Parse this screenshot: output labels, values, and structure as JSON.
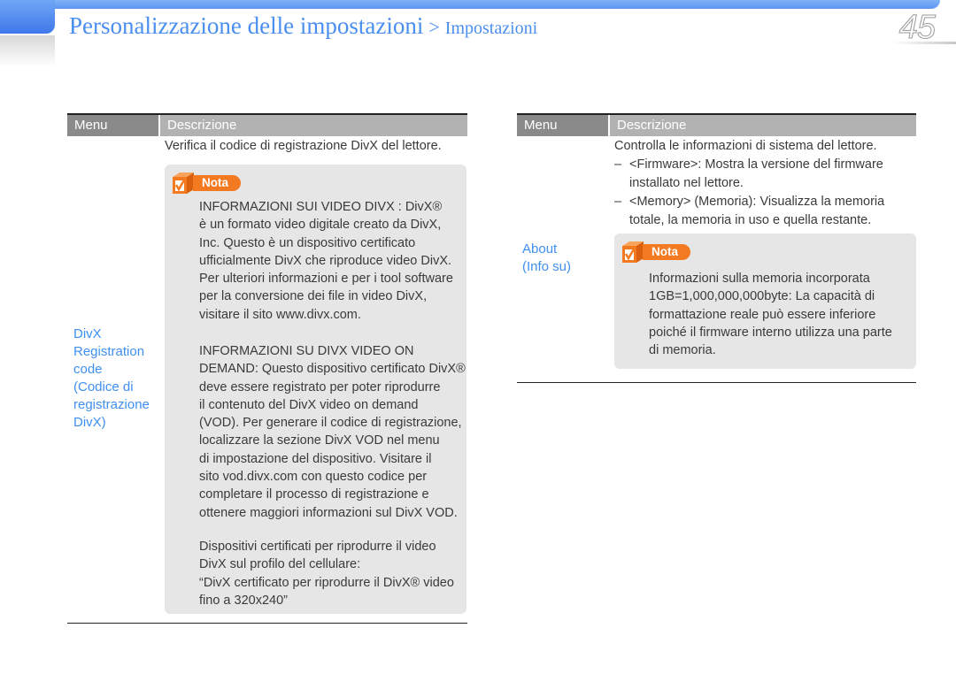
{
  "header": {
    "title": "Personalizzazione delle impostazioni",
    "separator": ">",
    "subtitle": "Impostazioni",
    "page_number": "45",
    "accent_color": "#4a8ef0"
  },
  "left_table": {
    "col_menu": "Menu",
    "col_desc": "Descrizione",
    "row": {
      "menu_lines": [
        "DivX",
        "Registration",
        "code",
        "(Codice di",
        "registrazione",
        "DivX)"
      ],
      "description": "Verifica il codice di registrazione DivX del lettore.",
      "note": {
        "badge": "Nota",
        "icon": "checkbox-cube-icon",
        "paragraphs": [
          [
            "INFORMAZIONI SUI VIDEO DIVX : DivX®",
            "è un formato video digitale creato da DivX,",
            "Inc. Questo è un dispositivo certificato",
            "ufficialmente DivX che riproduce video DivX.",
            "Per ulteriori informazioni e per i tool software",
            "per la conversione dei file in video DivX,",
            "visitare il sito www.divx.com."
          ],
          [
            "INFORMAZIONI SU DIVX VIDEO ON",
            "DEMAND: Questo dispositivo certificato DivX®",
            "deve essere registrato per poter riprodurre",
            "il contenuto del DivX video on demand",
            "(VOD). Per generare il codice di registrazione,",
            "localizzare la sezione DivX VOD nel menu",
            "di impostazione del dispositivo. Visitare il",
            "sito vod.divx.com con questo codice per",
            "completare il processo di registrazione e",
            "ottenere maggiori informazioni sul DivX VOD."
          ],
          [
            "Dispositivi certificati per riprodurre il video",
            "DivX sul profilo del cellulare:",
            "“DivX certificato per riprodurre il DivX® video",
            "fino a 320x240”"
          ]
        ]
      }
    }
  },
  "right_table": {
    "col_menu": "Menu",
    "col_desc": "Descrizione",
    "row": {
      "menu_lines": [
        "About",
        "(Info su)"
      ],
      "description": "Controlla le informazioni di sistema del lettore.",
      "items": [
        [
          "<Firmware>: Mostra la versione del firmware",
          "installato nel lettore."
        ],
        [
          "<Memory> (Memoria): Visualizza la memoria",
          "totale, la memoria in uso e quella restante."
        ]
      ],
      "dash": "–",
      "note": {
        "badge": "Nota",
        "icon": "checkbox-cube-icon",
        "lines": [
          "Informazioni sulla memoria incorporata",
          "1GB=1,000,000,000byte: La capacità di",
          "formattazione reale può essere inferiore",
          "poiché il firmware interno utilizza una parte",
          "di memoria."
        ]
      }
    }
  },
  "colors": {
    "note_orange": "#f47a22",
    "menu_link_blue": "#3f8ff0",
    "note_bg": "#e6e6e6"
  }
}
